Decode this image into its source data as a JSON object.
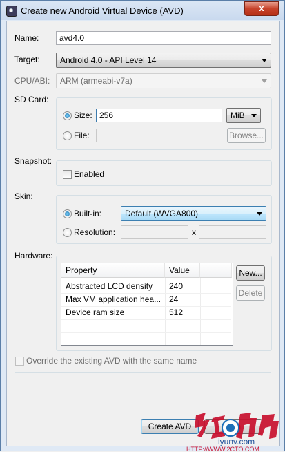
{
  "window": {
    "title": "Create new Android Virtual Device (AVD)",
    "close_glyph": "x"
  },
  "form": {
    "name": {
      "label": "Name:",
      "value": "avd4.0"
    },
    "target": {
      "label": "Target:",
      "value": "Android 4.0 - API Level 14"
    },
    "cpu": {
      "label": "CPU/ABI:",
      "value": "ARM (armeabi-v7a)"
    },
    "sdcard": {
      "label": "SD Card:",
      "size_label": "Size:",
      "size_value": "256",
      "unit": "MiB",
      "file_label": "File:",
      "file_value": "",
      "browse_label": "Browse..."
    },
    "snapshot": {
      "label": "Snapshot:",
      "enabled_label": "Enabled"
    },
    "skin": {
      "label": "Skin:",
      "builtin_label": "Built-in:",
      "builtin_value": "Default (WVGA800)",
      "resolution_label": "Resolution:",
      "x_label": "x"
    },
    "hardware": {
      "label": "Hardware:",
      "columns": [
        "Property",
        "Value"
      ],
      "rows": [
        {
          "property": "Abstracted LCD density",
          "value": "240"
        },
        {
          "property": "Max VM application hea...",
          "value": "24"
        },
        {
          "property": "Device ram size",
          "value": "512"
        }
      ],
      "new_label": "New...",
      "delete_label": "Delete"
    },
    "override_label": "Override the existing AVD with the same name"
  },
  "actions": {
    "create_label": "Create AVD",
    "cancel_label": "Can"
  },
  "watermark": {
    "url": "iyunv.com",
    "footer": "HTTP://WWW.2CTO.COM"
  },
  "colors": {
    "title_gradient": "#c9d9ee",
    "close_red": "#c7432b",
    "accent_blue": "#3c7fb1"
  }
}
